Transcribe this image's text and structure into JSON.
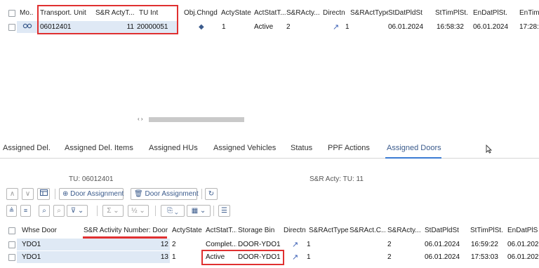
{
  "top_table": {
    "headers": [
      "Mo..",
      "Transport. Unit",
      "S&R ActyT...",
      "TU Int",
      "Obj.Chngd",
      "ActyState",
      "ActStatT...",
      "S&RActy...",
      "Directn",
      "S&RActType",
      "StDatPldSt",
      "StTimPlSt.",
      "EnDatPlSt.",
      "EnTim"
    ],
    "row": {
      "mode_icon": "glasses-icon",
      "transport_unit": "06012401",
      "sr_acty_type": "11",
      "tu_int": "20000051",
      "obj_changed_icon": "diamond-icon",
      "acty_state": "1",
      "act_stat_text": "Active",
      "sr_acty": "2",
      "direction_icon": "arrow-up-right-icon",
      "sr_act_type": "1",
      "st_dat_pld": "06.01.2024",
      "st_tim_pl": "16:58:32",
      "en_dat_pl": "06.01.2024",
      "en_tim": "17:28:"
    }
  },
  "scroll_arrows": "‹ ›",
  "tabs": [
    "Assigned Del.",
    "Assigned Del. Items",
    "Assigned HUs",
    "Assigned Vehicles",
    "Status",
    "PPF Actions",
    "Assigned Doors"
  ],
  "active_tab": "Assigned Doors",
  "info": {
    "tu_label": "TU: 06012401",
    "sr_acty_label": "S&R Acty: TU:  11"
  },
  "toolbar": {
    "door_assign_label": "Door Assignment",
    "door_unassign_label": "Door Assignment"
  },
  "bottom_table": {
    "headers": [
      "Whse Door",
      "S&R Activity Number: Door",
      "ActyState",
      "ActStatT...",
      "Storage Bin",
      "Directn",
      "S&RActType",
      "S&RAct.C...",
      "S&RActy...",
      "StDatPldSt",
      "StTimPlSt.",
      "EnDatPlS"
    ],
    "rows": [
      {
        "whse_door": "YDO1",
        "sr_activity_number": "12",
        "acty_state": "2",
        "act_stat_text": "Complet...",
        "storage_bin": "DOOR-YDO1",
        "sr_act_type": "1",
        "sr_acty": "2",
        "st_dat_pld": "06.01.2024",
        "st_tim_pl": "16:59:22",
        "en_dat_pl": "06.01.202"
      },
      {
        "whse_door": "YDO1",
        "sr_activity_number": "13",
        "acty_state": "1",
        "act_stat_text": "Active",
        "storage_bin": "DOOR-YDO1",
        "sr_act_type": "1",
        "sr_acty": "2",
        "st_dat_pld": "06.01.2024",
        "st_tim_pl": "17:53:03",
        "en_dat_pl": "06.01.202"
      }
    ]
  },
  "colors": {
    "highlight_red": "#e03030",
    "selection_blue": "#dfe9f5",
    "link_blue": "#3b5b8c",
    "tab_underline": "#3b7bd4"
  }
}
